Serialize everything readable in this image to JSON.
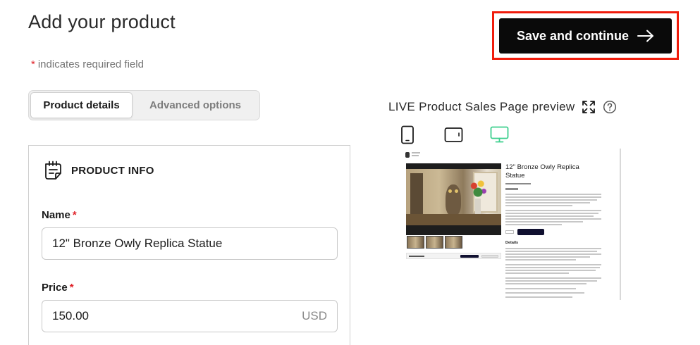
{
  "header": {
    "title": "Add your product",
    "required_star": "*",
    "required_note": "indicates required field",
    "save_button": "Save and continue"
  },
  "tabs": [
    {
      "label": "Product details",
      "active": true
    },
    {
      "label": "Advanced options",
      "active": false
    }
  ],
  "product_info": {
    "title": "PRODUCT INFO",
    "name_label": "Name",
    "name_required": "*",
    "name_value": "12\" Bronze Owly Replica Statue",
    "price_label": "Price",
    "price_required": "*",
    "price_value": "150.00",
    "price_unit": "USD"
  },
  "preview": {
    "title": "LIVE Product Sales Page preview",
    "icons": [
      "expand-icon",
      "help-icon"
    ],
    "devices": [
      {
        "name": "mobile",
        "icon": "mobile-icon",
        "active": false
      },
      {
        "name": "tablet",
        "icon": "tablet-icon",
        "active": false
      },
      {
        "name": "desktop",
        "icon": "desktop-icon",
        "active": true
      }
    ],
    "product_title": "12\" Bronze Owly Replica Statue",
    "details_label": "Details"
  },
  "colors": {
    "accent_active_device": "#3ccf8e",
    "highlight": "#f01c0c",
    "required": "#e0242b",
    "primary_button": "#0a0a0a"
  }
}
